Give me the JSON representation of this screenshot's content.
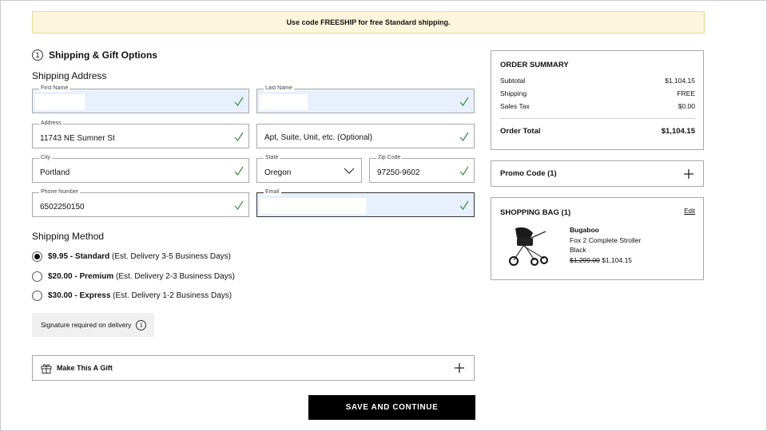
{
  "banner": {
    "text": "Use code FREESHIP for free Standard shipping."
  },
  "section": {
    "step": "1",
    "title": "Shipping & Gift Options"
  },
  "shipping_address": {
    "heading": "Shipping Address",
    "first_name": {
      "label": "First Name",
      "value": ""
    },
    "last_name": {
      "label": "Last Name",
      "value": ""
    },
    "address": {
      "label": "Address",
      "value": "11743 NE Sumner St"
    },
    "apt": {
      "placeholder": "Apt, Suite, Unit, etc. (Optional)"
    },
    "city": {
      "label": "City",
      "value": "Portland"
    },
    "state": {
      "label": "State",
      "value": "Oregon"
    },
    "zip": {
      "label": "Zip Code",
      "value": "97250-9602"
    },
    "phone": {
      "label": "Phone Number",
      "value": "6502250150"
    },
    "email": {
      "label": "Email",
      "value": ""
    }
  },
  "shipping_method": {
    "heading": "Shipping Method",
    "options": [
      {
        "price": "$9.95 - Standard",
        "detail": " (Est. Delivery 3-5 Business Days)",
        "selected": true
      },
      {
        "price": "$20.00 - Premium",
        "detail": " (Est. Delivery 2-3 Business Days)",
        "selected": false
      },
      {
        "price": "$30.00 - Express",
        "detail": " (Est. Delivery 1-2 Business Days)",
        "selected": false
      }
    ]
  },
  "signature": {
    "text": "Signature required on delivery",
    "icon": "info-icon"
  },
  "gift": {
    "label": "Make This A Gift",
    "icon": "gift-icon"
  },
  "save_button": {
    "label": "SAVE AND CONTINUE"
  },
  "order_summary": {
    "title": "ORDER SUMMARY",
    "rows": [
      {
        "label": "Subtotal",
        "value": "$1,104.15"
      },
      {
        "label": "Shipping",
        "value": "FREE"
      },
      {
        "label": "Sales Tax",
        "value": "$0.00"
      }
    ],
    "total_label": "Order Total",
    "total_value": "$1,104.15"
  },
  "promo": {
    "label": "Promo Code (1)"
  },
  "bag": {
    "title": "SHOPPING BAG (1)",
    "edit_label": "Edit",
    "item": {
      "brand": "Bugaboo",
      "name": "Fox 2 Complete Stroller",
      "color": "Black",
      "original_price": "$1,299.00",
      "sale_price": "$1,104.15"
    }
  },
  "colors": {
    "banner_bg": "#fdf6dc",
    "autofill_bg": "#e8f0fe",
    "check": "#3a8a3a",
    "button_bg": "#000000"
  }
}
